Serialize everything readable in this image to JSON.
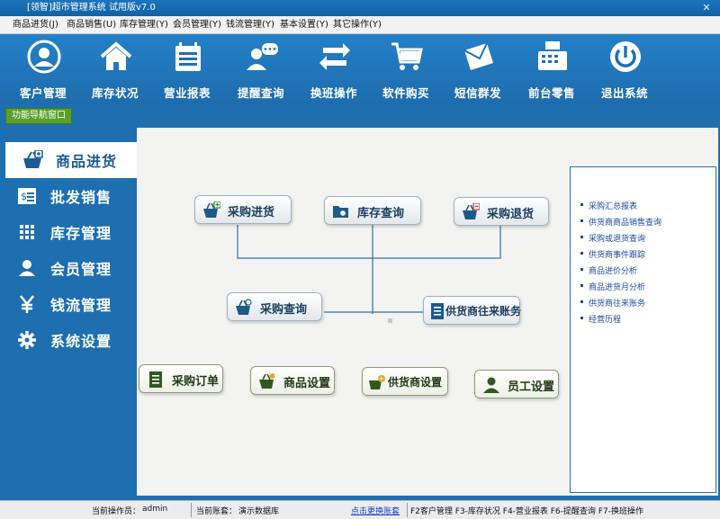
{
  "window": {
    "title": "[领智]超市管理系统 试用版v7.0",
    "close_glyph": "✕"
  },
  "menu": [
    "商品进货(J)",
    "商品销售(U)",
    "库存管理(Y)",
    "会员管理(Y)",
    "钱流管理(Y)",
    "基本设置(Y)",
    "其它操作(Y)"
  ],
  "toolbar": [
    {
      "label": "客户管理",
      "icon": "user-circle-icon"
    },
    {
      "label": "库存状况",
      "icon": "home-icon"
    },
    {
      "label": "营业报表",
      "icon": "calendar-report-icon"
    },
    {
      "label": "提醒查询",
      "icon": "chat-user-icon"
    },
    {
      "label": "换班操作",
      "icon": "swap-arrows-icon"
    },
    {
      "label": "软件购买",
      "icon": "shopping-cart-icon"
    },
    {
      "label": "短信群发",
      "icon": "envelope-icon"
    },
    {
      "label": "前台零售",
      "icon": "cash-register-icon"
    },
    {
      "label": "退出系统",
      "icon": "power-icon"
    }
  ],
  "nav_tag": "功能导航窗口",
  "sidebar": [
    {
      "label": "商品进货",
      "icon": "basket-icon",
      "active": true
    },
    {
      "label": "批发销售",
      "icon": "invoice-icon"
    },
    {
      "label": "库存管理",
      "icon": "grid-icon"
    },
    {
      "label": "会员管理",
      "icon": "person-icon"
    },
    {
      "label": "钱流管理",
      "icon": "yen-icon"
    },
    {
      "label": "系统设置",
      "icon": "gear-icon"
    }
  ],
  "flow": {
    "purchase_in": "采购进货",
    "stock_query": "库存查询",
    "purchase_return": "采购退货",
    "purchase_query": "采购查询",
    "supplier_accounts": "供货商往来账务"
  },
  "settings": {
    "purchase_order": "采购订单",
    "goods_settings": "商品设置",
    "supplier_settings": "供货商设置",
    "staff_settings": "员工设置"
  },
  "quick_links": [
    "采购汇总报表",
    "供货商商品销售查询",
    "采购或退货查询",
    "供货商事件跟踪",
    "商品进价分析",
    "商品进货月分析",
    "供货商往来账务",
    "经营历程"
  ],
  "status": {
    "operator_label": "当前操作员：",
    "operator": "admin",
    "account_label": "当前账套：",
    "account": "演示数据库",
    "switch_link": "点击更换账套",
    "shortcuts": "F2客户管理 F3-库存状况 F4-营业报表 F6-提醒查询 F7-换班操作"
  },
  "colors": {
    "brand_blue": "#1e6fb0",
    "nav_green": "#5aa02c",
    "link_blue": "#1a4aa3"
  }
}
